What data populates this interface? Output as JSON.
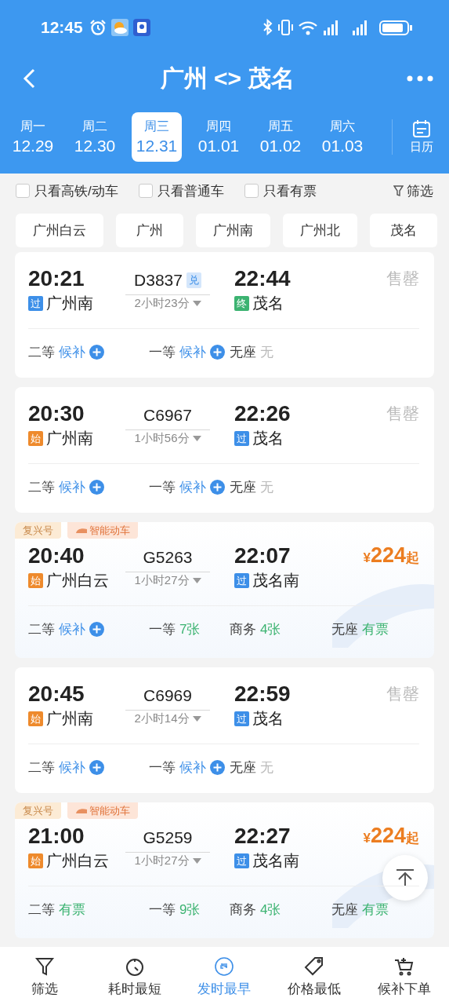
{
  "status_bar": {
    "time": "12:45"
  },
  "header": {
    "title": "广州 <> 茂名"
  },
  "dates": [
    {
      "weekday": "周一",
      "date": "12.29",
      "selected": false
    },
    {
      "weekday": "周二",
      "date": "12.30",
      "selected": false
    },
    {
      "weekday": "周三",
      "date": "12.31",
      "selected": true
    },
    {
      "weekday": "周四",
      "date": "01.01",
      "selected": false
    },
    {
      "weekday": "周五",
      "date": "01.02",
      "selected": false
    },
    {
      "weekday": "周六",
      "date": "01.03",
      "selected": false
    }
  ],
  "calendar_button": "日历",
  "filters": [
    {
      "label": "只看高铁/动车",
      "checked": false
    },
    {
      "label": "只看普通车",
      "checked": false
    },
    {
      "label": "只看有票",
      "checked": false
    }
  ],
  "filter_button": "筛选",
  "stations": [
    "广州白云",
    "广州",
    "广州南",
    "广州北",
    "茂名"
  ],
  "trains": [
    {
      "depart": "20:21",
      "number": "D3837",
      "badge": "兑",
      "arrive": "22:44",
      "from_tag": {
        "text": "过",
        "kind": "pass"
      },
      "from": "广州南",
      "duration": "2小时23分",
      "to_tag": {
        "text": "终",
        "kind": "end"
      },
      "to": "茂名",
      "status": {
        "kind": "soldout",
        "text": "售罄"
      },
      "seats": [
        {
          "class": "二等",
          "status": "候补",
          "kind": "waitlist"
        },
        {
          "class": "一等",
          "status": "候补",
          "kind": "waitlist"
        },
        {
          "class": "无座",
          "status": "无",
          "kind": "none"
        }
      ]
    },
    {
      "depart": "20:30",
      "number": "C6967",
      "arrive": "22:26",
      "from_tag": {
        "text": "始",
        "kind": "start"
      },
      "from": "广州南",
      "duration": "1小时56分",
      "to_tag": {
        "text": "过",
        "kind": "pass"
      },
      "to": "茂名",
      "status": {
        "kind": "soldout",
        "text": "售罄"
      },
      "seats": [
        {
          "class": "二等",
          "status": "候补",
          "kind": "waitlist"
        },
        {
          "class": "一等",
          "status": "候补",
          "kind": "waitlist"
        },
        {
          "class": "无座",
          "status": "无",
          "kind": "none"
        }
      ]
    },
    {
      "labels": [
        {
          "text": "复兴号",
          "kind": "plain"
        },
        {
          "text": "智能动车",
          "kind": "smart"
        }
      ],
      "depart": "20:40",
      "number": "G5263",
      "arrive": "22:07",
      "from_tag": {
        "text": "始",
        "kind": "start"
      },
      "from": "广州白云",
      "duration": "1小时27分",
      "to_tag": {
        "text": "过",
        "kind": "pass"
      },
      "to": "茂名南",
      "status": {
        "kind": "price",
        "currency": "¥",
        "amount": "224",
        "suffix": "起"
      },
      "seats": [
        {
          "class": "二等",
          "status": "候补",
          "kind": "waitlist"
        },
        {
          "class": "一等",
          "status": "7张",
          "kind": "available"
        },
        {
          "class": "商务",
          "status": "4张",
          "kind": "available"
        },
        {
          "class": "无座",
          "status": "有票",
          "kind": "available"
        }
      ]
    },
    {
      "depart": "20:45",
      "number": "C6969",
      "arrive": "22:59",
      "from_tag": {
        "text": "始",
        "kind": "start"
      },
      "from": "广州南",
      "duration": "2小时14分",
      "to_tag": {
        "text": "过",
        "kind": "pass"
      },
      "to": "茂名",
      "status": {
        "kind": "soldout",
        "text": "售罄"
      },
      "seats": [
        {
          "class": "二等",
          "status": "候补",
          "kind": "waitlist"
        },
        {
          "class": "一等",
          "status": "候补",
          "kind": "waitlist"
        },
        {
          "class": "无座",
          "status": "无",
          "kind": "none"
        }
      ]
    },
    {
      "labels": [
        {
          "text": "复兴号",
          "kind": "plain"
        },
        {
          "text": "智能动车",
          "kind": "smart"
        }
      ],
      "depart": "21:00",
      "number": "G5259",
      "arrive": "22:27",
      "from_tag": {
        "text": "始",
        "kind": "start"
      },
      "from": "广州白云",
      "duration": "1小时27分",
      "to_tag": {
        "text": "过",
        "kind": "pass"
      },
      "to": "茂名南",
      "status": {
        "kind": "price",
        "currency": "¥",
        "amount": "224",
        "suffix": "起"
      },
      "seats": [
        {
          "class": "二等",
          "status": "有票",
          "kind": "available"
        },
        {
          "class": "一等",
          "status": "9张",
          "kind": "available"
        },
        {
          "class": "商务",
          "status": "4张",
          "kind": "available"
        },
        {
          "class": "无座",
          "status": "有票",
          "kind": "available"
        }
      ]
    }
  ],
  "bottom_nav": [
    {
      "label": "筛选",
      "kind": "filter",
      "selected": false
    },
    {
      "label": "耗时最短",
      "kind": "timer",
      "selected": false
    },
    {
      "label": "发时最早",
      "kind": "clock24",
      "selected": true
    },
    {
      "label": "价格最低",
      "kind": "tag",
      "selected": false
    },
    {
      "label": "候补下单",
      "kind": "cart",
      "selected": false
    }
  ]
}
